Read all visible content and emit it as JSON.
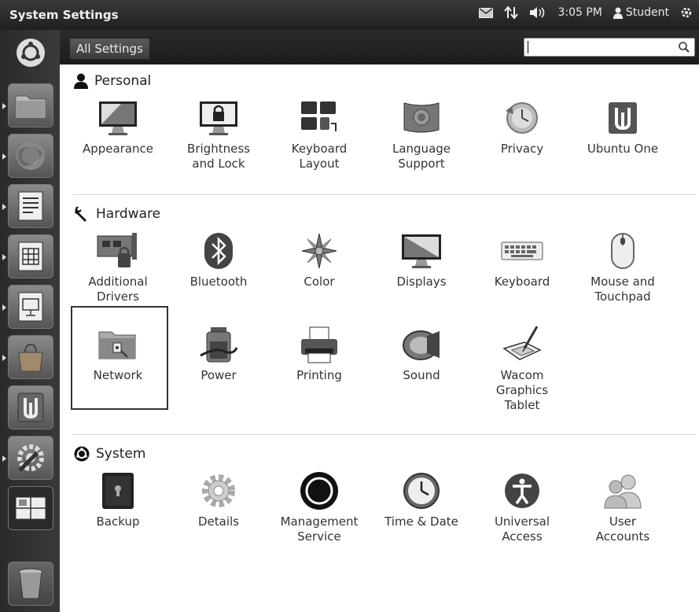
{
  "panel": {
    "title": "System Settings",
    "time": "3:05 PM",
    "user": "Student",
    "indicator_icons": [
      "mail-icon",
      "network-arrows-icon",
      "volume-icon",
      "power-gear-icon"
    ]
  },
  "toolbar": {
    "all_settings_label": "All Settings",
    "search": {
      "value": "",
      "placeholder": ""
    }
  },
  "launcher": {
    "items": [
      "dash-home-icon",
      "files-icon",
      "firefox-icon",
      "writer-icon",
      "calc-icon",
      "impress-icon",
      "software-center-icon",
      "ubuntu-one-icon",
      "system-settings-icon",
      "workspace-switcher-icon",
      "trash-icon"
    ]
  },
  "sections": {
    "personal": {
      "title": "Personal",
      "items": [
        {
          "label": "Appearance",
          "icon": "appearance-icon"
        },
        {
          "label": "Brightness\nand Lock",
          "icon": "brightness-lock-icon"
        },
        {
          "label": "Keyboard\nLayout",
          "icon": "keyboard-layout-icon"
        },
        {
          "label": "Language\nSupport",
          "icon": "language-support-icon"
        },
        {
          "label": "Privacy",
          "icon": "privacy-icon"
        },
        {
          "label": "Ubuntu One",
          "icon": "ubuntu-one-icon"
        }
      ]
    },
    "hardware": {
      "title": "Hardware",
      "items": [
        {
          "label": "Additional\nDrivers",
          "icon": "additional-drivers-icon"
        },
        {
          "label": "Bluetooth",
          "icon": "bluetooth-icon"
        },
        {
          "label": "Color",
          "icon": "color-icon"
        },
        {
          "label": "Displays",
          "icon": "displays-icon"
        },
        {
          "label": "Keyboard",
          "icon": "keyboard-icon"
        },
        {
          "label": "Mouse and\nTouchpad",
          "icon": "mouse-icon"
        },
        {
          "label": "Network",
          "icon": "network-icon"
        },
        {
          "label": "Power",
          "icon": "power-icon"
        },
        {
          "label": "Printing",
          "icon": "printer-icon"
        },
        {
          "label": "Sound",
          "icon": "sound-icon"
        },
        {
          "label": "Wacom\nGraphics\nTablet",
          "icon": "wacom-tablet-icon"
        }
      ]
    },
    "system": {
      "title": "System",
      "items": [
        {
          "label": "Backup",
          "icon": "backup-icon"
        },
        {
          "label": "Details",
          "icon": "details-icon"
        },
        {
          "label": "Management\nService",
          "icon": "management-service-icon"
        },
        {
          "label": "Time & Date",
          "icon": "clock-icon"
        },
        {
          "label": "Universal\nAccess",
          "icon": "universal-access-icon"
        },
        {
          "label": "User\nAccounts",
          "icon": "user-accounts-icon"
        }
      ]
    }
  },
  "selected_item": "Network"
}
